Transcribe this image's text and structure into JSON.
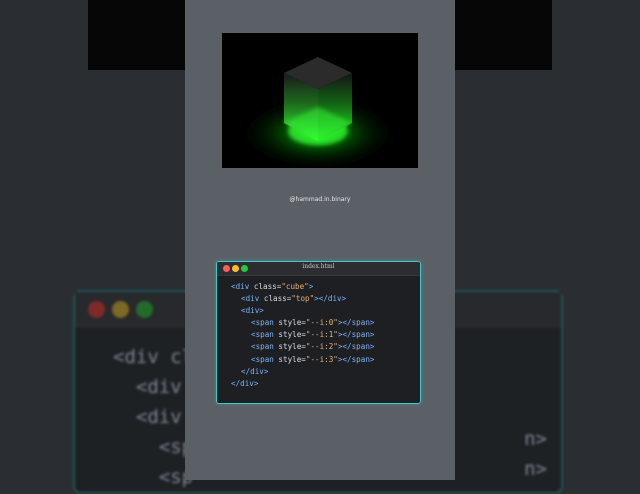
{
  "watermark": "@hammad.in.binary",
  "editor": {
    "filename": "index.html",
    "dots": [
      "#ff5f56",
      "#ffbd2e",
      "#27c93f"
    ],
    "lines": [
      {
        "indent": 0,
        "tag": "<div",
        "attr": " class=",
        "str": "\"cube\"",
        "close": ">"
      },
      {
        "indent": 1,
        "tag": "<div",
        "attr": " class=",
        "str": "\"top\"",
        "close": "></div>"
      },
      {
        "indent": 1,
        "tag": "<div>",
        "attr": "",
        "str": "",
        "close": ""
      },
      {
        "indent": 2,
        "tag": "<span",
        "attr": " style=",
        "str": "\"--i:0\"",
        "close": "></span>"
      },
      {
        "indent": 2,
        "tag": "<span",
        "attr": " style=",
        "str": "\"--i:1\"",
        "close": "></span>"
      },
      {
        "indent": 2,
        "tag": "<span",
        "attr": " style=",
        "str": "\"--i:2\"",
        "close": "></span>"
      },
      {
        "indent": 2,
        "tag": "<span",
        "attr": " style=",
        "str": "\"--i:3\"",
        "close": "></span>"
      },
      {
        "indent": 1,
        "tag": "</div>",
        "attr": "",
        "str": "",
        "close": ""
      },
      {
        "indent": 0,
        "tag": "</div>",
        "attr": "",
        "str": "",
        "close": ""
      }
    ]
  },
  "background": {
    "code_fragments": [
      "<div cl",
      "<div",
      "<div",
      "<sp",
      "<sp"
    ],
    "right_fragments": [
      "n>",
      "n>"
    ]
  },
  "colors": {
    "accent": "#3fc9c8",
    "glow": "#2dff2d"
  }
}
